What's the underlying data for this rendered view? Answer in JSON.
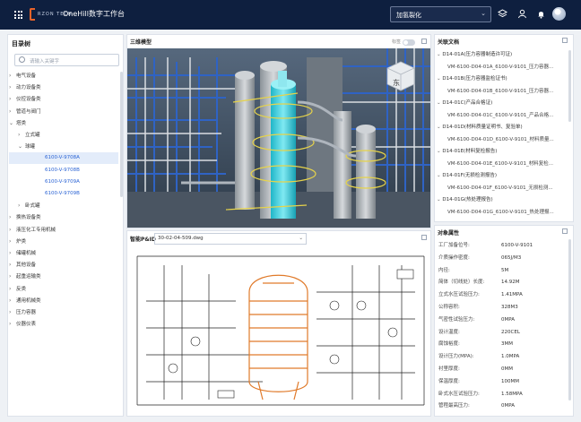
{
  "topbar": {
    "brand": "RZON TECH",
    "title": "OneHill数字工作台",
    "project": "加氢裂化",
    "icons": [
      "grid-icon",
      "layers-icon",
      "user-icon",
      "bell-icon",
      "avatar"
    ],
    "bg_color": "#0e1f3f",
    "accent_color": "#e8632a"
  },
  "tree": {
    "title": "目录树",
    "search_placeholder": "请输入关键字",
    "items": [
      {
        "label": "电气设备",
        "arrow": "›"
      },
      {
        "label": "动力设备类",
        "arrow": "›"
      },
      {
        "label": "仪控设备类",
        "arrow": "›"
      },
      {
        "label": "管道与阀门",
        "arrow": "›"
      },
      {
        "label": "塔类",
        "arrow": "⌄"
      },
      {
        "label": "立式罐",
        "arrow": "›"
      },
      {
        "label": "球罐",
        "arrow": "⌄"
      },
      {
        "label": "6100-V-9708A",
        "arrow": ""
      },
      {
        "label": "6100-V-9708B",
        "arrow": ""
      },
      {
        "label": "6100-V-9709A",
        "arrow": ""
      },
      {
        "label": "6100-V-9709B",
        "arrow": ""
      },
      {
        "label": "卧式罐",
        "arrow": "›"
      },
      {
        "label": "换热设备类",
        "arrow": "›"
      },
      {
        "label": "液压化工专用机械",
        "arrow": "›"
      },
      {
        "label": "炉类",
        "arrow": "›"
      },
      {
        "label": "储罐机械",
        "arrow": "›"
      },
      {
        "label": "其他设备",
        "arrow": "›"
      },
      {
        "label": "起重运输类",
        "arrow": "›"
      },
      {
        "label": "反类",
        "arrow": "›"
      },
      {
        "label": "通用机械类",
        "arrow": "›"
      },
      {
        "label": "压力容器",
        "arrow": "›"
      },
      {
        "label": "仪器仪表",
        "arrow": "›"
      }
    ],
    "selected": "6100-V-9708A"
  },
  "view3d": {
    "title": "三维模型",
    "toggle_label": "标签",
    "compass_label": "东"
  },
  "pid": {
    "title": "智能P&ID",
    "drawing": "30-02-04-509.dwg"
  },
  "docs": {
    "title": "关联文档",
    "items": [
      {
        "type": "h",
        "label": "D14-01A(压力容器制造许可证)"
      },
      {
        "type": "f",
        "label": "VM-6100-D04-01A_6100-V-9101_压力容器..."
      },
      {
        "type": "h",
        "label": "D14-01B(压力容器监检证书)"
      },
      {
        "type": "f",
        "label": "VM-6100-D04-01B_6100-V-9101_压力容器..."
      },
      {
        "type": "h",
        "label": "D14-01C(产品合格证)"
      },
      {
        "type": "f",
        "label": "VM-6100-D04-01C_6100-V-9101_产品合格..."
      },
      {
        "type": "h",
        "label": "D14-01D(材料质量证明书、复验单)"
      },
      {
        "type": "f",
        "label": "VM-6100-D04-01D_6100-V-9101_材料质量..."
      },
      {
        "type": "h",
        "label": "D14-01E(材料复检报告)"
      },
      {
        "type": "f",
        "label": "VM-6100-D04-01E_6100-V-9101_材料复检..."
      },
      {
        "type": "h",
        "label": "D14-01F(无损检测报告)"
      },
      {
        "type": "f",
        "label": "VM-6100-D04-01F_6100-V-9101_无损检测..."
      },
      {
        "type": "h",
        "label": "D14-01G(热处理报告)"
      },
      {
        "type": "f",
        "label": "VM-6100-D04-01G_6100-V-9101_热处理报..."
      }
    ]
  },
  "props": {
    "title": "对象属性",
    "rows": [
      {
        "k": "工厂加备位号:",
        "v": "6100-V-9101"
      },
      {
        "k": "介质操作密度:",
        "v": "065J/M3"
      },
      {
        "k": "内径:",
        "v": "5M"
      },
      {
        "k": "简体（切线处）长度:",
        "v": "14.92M"
      },
      {
        "k": "立式水压试验压力:",
        "v": "1.41MPA"
      },
      {
        "k": "公称容积:",
        "v": "328M3"
      },
      {
        "k": "气密性试验压力:",
        "v": "0MPA"
      },
      {
        "k": "设计温度:",
        "v": "220CEL"
      },
      {
        "k": "腐蚀裕度:",
        "v": "3MM"
      },
      {
        "k": "设计压力(MPA):",
        "v": "1.0MPA"
      },
      {
        "k": "衬里厚度:",
        "v": "0MM"
      },
      {
        "k": "保温厚度:",
        "v": "100MM"
      },
      {
        "k": "卧式水压试验压力:",
        "v": "1.58MPA"
      },
      {
        "k": "管程最高压力:",
        "v": "0MPA"
      }
    ]
  }
}
